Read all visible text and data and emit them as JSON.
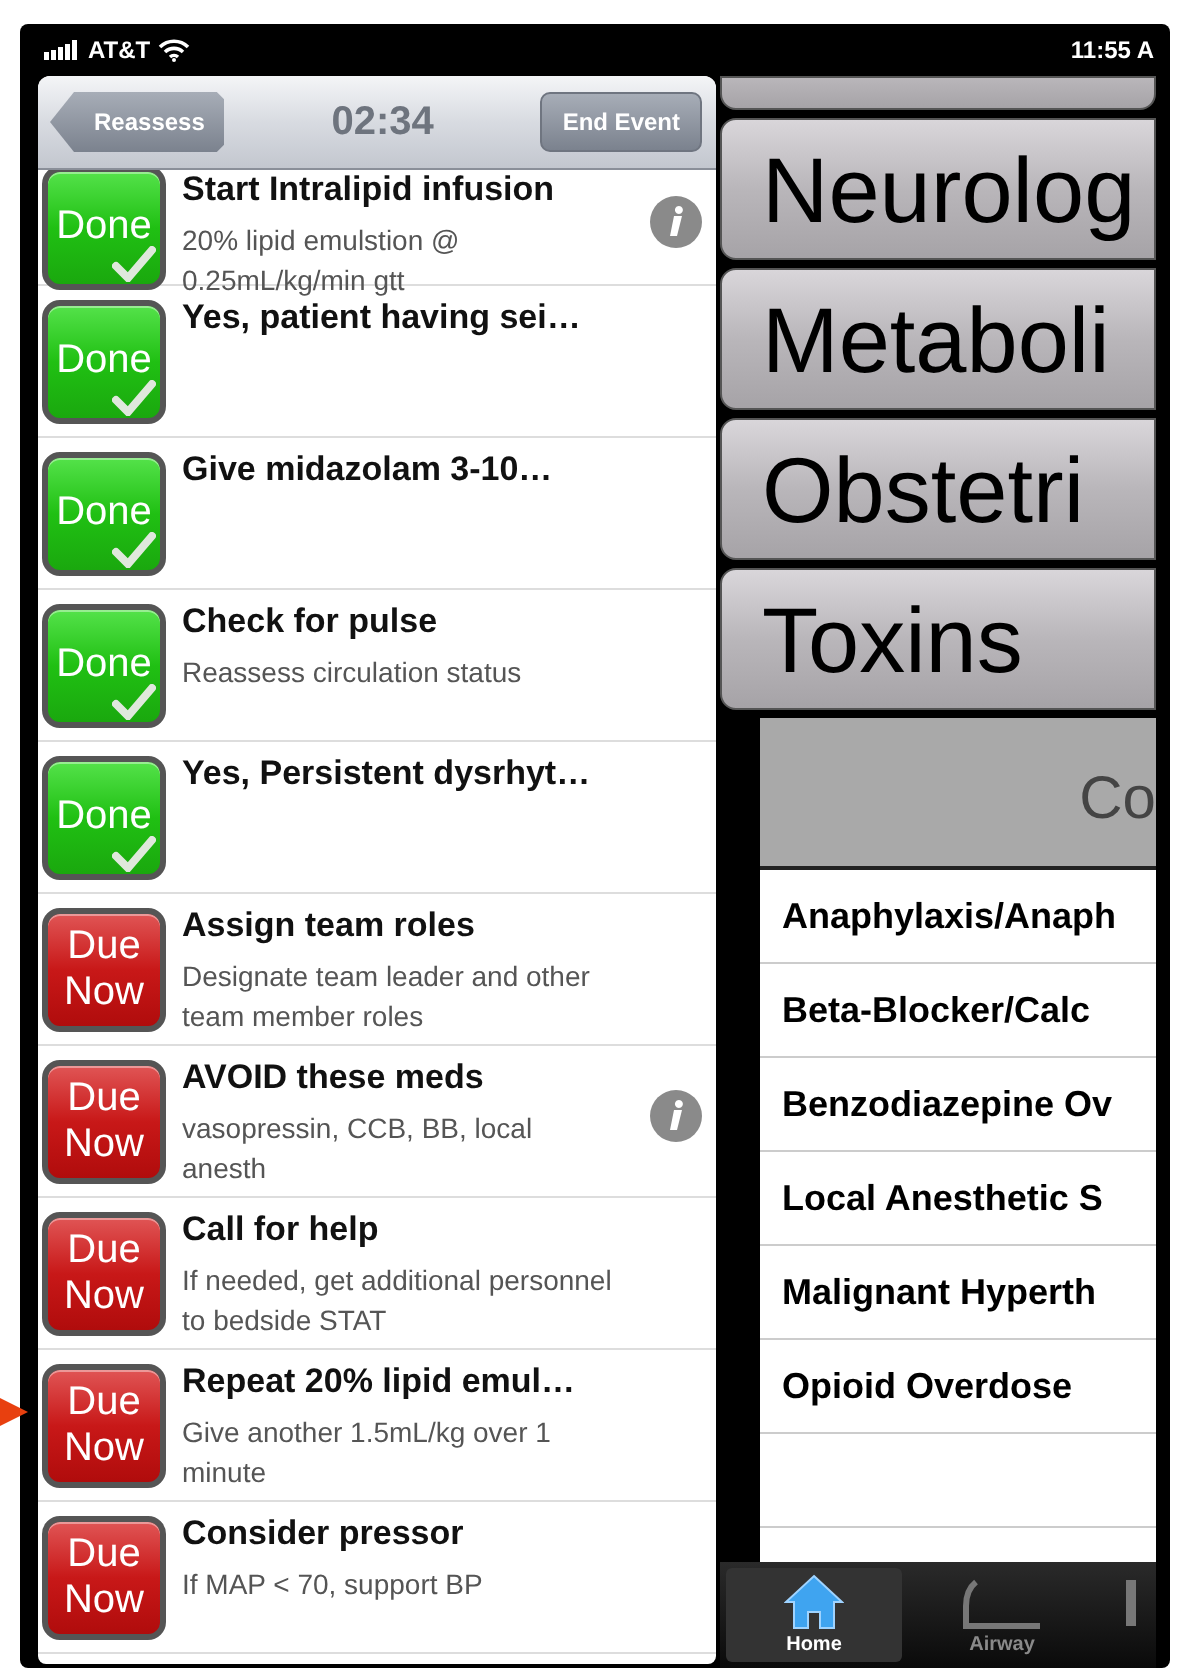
{
  "status_bar": {
    "carrier": "AT&T",
    "time": "11:55 A"
  },
  "nav_bar": {
    "back_button": "Reassess",
    "timer": "02:34",
    "end_button": "End Event"
  },
  "tasks": [
    {
      "kind": "done",
      "status_label": "Done",
      "title": "Start Intralipid infusion",
      "subtitle": "20% lipid emulstion @ 0.25mL/kg/min gtt",
      "info": true
    },
    {
      "kind": "done",
      "status_label": "Done",
      "title": "Yes, patient having sei…",
      "info": false
    },
    {
      "kind": "done",
      "status_label": "Done",
      "title": "Give midazolam 3-10…",
      "info": false
    },
    {
      "kind": "done",
      "status_label": "Done",
      "title": "Check for pulse",
      "subtitle": "Reassess circulation status",
      "info": false
    },
    {
      "kind": "done",
      "status_label": "Done",
      "title": "Yes, Persistent dysrhyt…",
      "info": false
    },
    {
      "kind": "due",
      "status_label": "Due Now",
      "title": "Assign team roles",
      "subtitle": "Designate team leader and other team member roles",
      "info": false
    },
    {
      "kind": "due",
      "status_label": "Due Now",
      "title": "AVOID these meds",
      "subtitle": "vasopressin, CCB, BB, local anesth",
      "info": true
    },
    {
      "kind": "due",
      "status_label": "Due Now",
      "title": "Call for help",
      "subtitle": "If needed, get additional personnel to bedside STAT",
      "info": false
    },
    {
      "kind": "due",
      "status_label": "Due Now",
      "title": "Repeat 20% lipid emul…",
      "subtitle": "Give another 1.5mL/kg over 1 minute",
      "info": false,
      "pointed": true
    },
    {
      "kind": "due",
      "status_label": "Due Now",
      "title": "Consider pressor",
      "subtitle": "If MAP < 70, support BP",
      "info": false
    }
  ],
  "categories": [
    {
      "label": "Neurolog"
    },
    {
      "label": "Metaboli"
    },
    {
      "label": "Obstetri"
    },
    {
      "label": "Toxins"
    }
  ],
  "toxin_header": "Co",
  "toxins": [
    "Anaphylaxis/Anaph",
    "Beta-Blocker/Calc",
    "Benzodiazepine Ov",
    "Local Anesthetic S",
    "Malignant Hyperth",
    "Opioid Overdose"
  ],
  "tabs": [
    {
      "label": "Home",
      "selected": true
    },
    {
      "label": "Airway",
      "selected": false
    }
  ]
}
